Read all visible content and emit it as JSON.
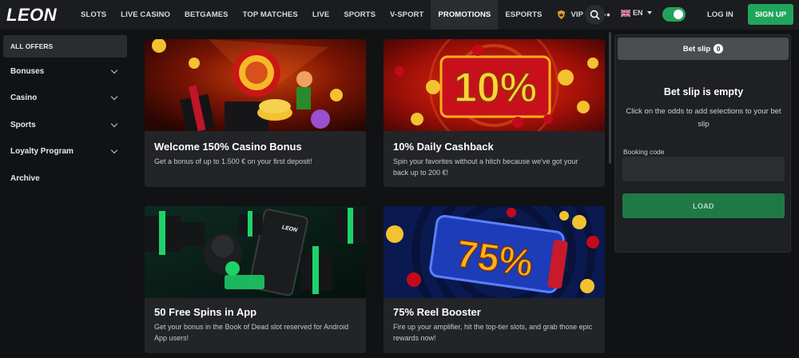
{
  "header": {
    "logo": "LEON",
    "nav": [
      "SLOTS",
      "LIVE CASINO",
      "BETGAMES",
      "TOP MATCHES",
      "LIVE",
      "SPORTS",
      "V-SPORT",
      "PROMOTIONS",
      "ESPORTS",
      "VIP"
    ],
    "active_nav": "PROMOTIONS",
    "more": "•••",
    "lang": "EN",
    "login": "LOG IN",
    "signup": "SIGN UP",
    "icons": {
      "search": "search-icon",
      "vip": "crown-shield-icon",
      "flag": "uk-flag-icon"
    }
  },
  "sidebar": {
    "items": [
      {
        "label": "ALL OFFERS",
        "expandable": false
      },
      {
        "label": "Bonuses",
        "expandable": true
      },
      {
        "label": "Casino",
        "expandable": true
      },
      {
        "label": "Sports",
        "expandable": true
      },
      {
        "label": "Loyalty Program",
        "expandable": true
      },
      {
        "label": "Archive",
        "expandable": false
      }
    ]
  },
  "promos": [
    {
      "title": "Welcome 150% Casino Bonus",
      "desc": "Get a bonus of up to 1.500 € on your first deposit!"
    },
    {
      "title": "10% Daily Cashback",
      "desc": "Spin your favorites without a hitch because we've got your back up to 200 €!",
      "art_text": "10%"
    },
    {
      "title": "50 Free Spins in App",
      "desc": "Get your bonus in the Book of Dead slot reserved for Android App users!",
      "art_text": "LEON"
    },
    {
      "title": "75% Reel Booster",
      "desc": "Fire up your amplifier, hit the top-tier slots, and grab those epic rewards now!",
      "art_text": "75%"
    }
  ],
  "betslip": {
    "tab": "Bet slip",
    "count": "0",
    "empty_title": "Bet slip is empty",
    "hint": "Click on the odds to add selections to your bet slip",
    "booking_label": "Booking code",
    "booking_value": "",
    "load": "LOAD"
  },
  "colors": {
    "accent": "#1fa55c",
    "bg": "#111214",
    "card": "#222427",
    "header": "#1b1c1f"
  }
}
